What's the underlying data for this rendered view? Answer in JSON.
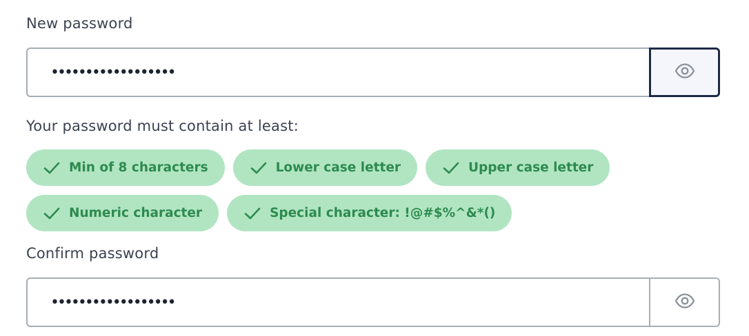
{
  "new_password": {
    "label": "New password",
    "value": "••••••••••••••••••",
    "visibility_icon": "eye-icon"
  },
  "requirements": {
    "title": "Your password must contain at least:",
    "items": [
      {
        "label": "Min of 8 characters",
        "met": true,
        "icon": "check-icon"
      },
      {
        "label": "Lower case letter",
        "met": true,
        "icon": "check-icon"
      },
      {
        "label": "Upper case letter",
        "met": true,
        "icon": "check-icon"
      },
      {
        "label": "Numeric character",
        "met": true,
        "icon": "check-icon"
      },
      {
        "label": "Special character: !@#$%^&*()",
        "met": true,
        "icon": "check-icon"
      }
    ]
  },
  "confirm_password": {
    "label": "Confirm password",
    "value": "••••••••••••••••••",
    "visibility_icon": "eye-icon"
  },
  "colors": {
    "chip_bg": "#b1e5c2",
    "chip_text": "#2d8a4e",
    "input_border": "#a7adb5",
    "focus_border": "#1d2a44"
  }
}
